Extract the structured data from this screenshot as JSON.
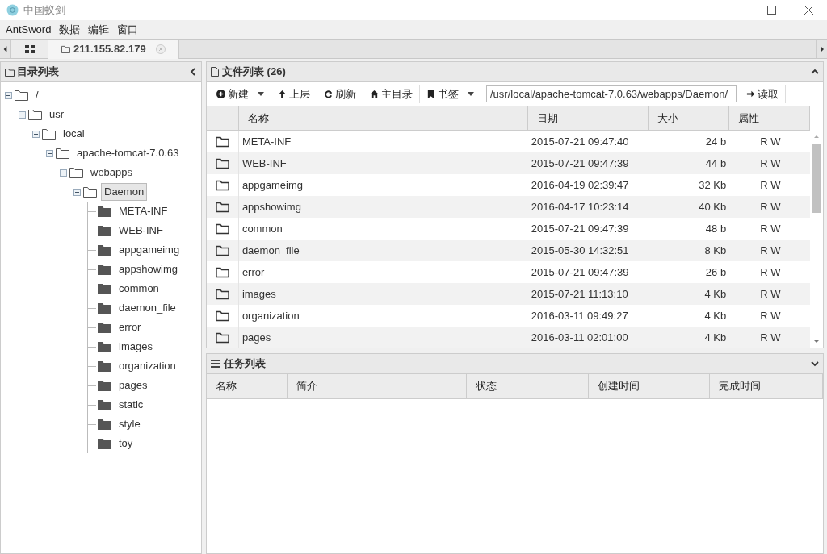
{
  "window": {
    "title": "中国蚁剑"
  },
  "menu": [
    "AntSword",
    "数据",
    "编辑",
    "窗口"
  ],
  "tabs": [
    {
      "label": "211.155.82.179",
      "selected": true
    }
  ],
  "directory_panel": {
    "title": "目录列表",
    "tree": [
      {
        "label": "/",
        "expanded": true,
        "selected": false,
        "children": [
          {
            "label": "usr",
            "expanded": true,
            "selected": false,
            "children": [
              {
                "label": "local",
                "expanded": true,
                "selected": false,
                "children": [
                  {
                    "label": "apache-tomcat-7.0.63",
                    "expanded": true,
                    "selected": false,
                    "children": [
                      {
                        "label": "webapps",
                        "expanded": true,
                        "selected": false,
                        "children": [
                          {
                            "label": "Daemon",
                            "expanded": true,
                            "selected": true,
                            "children": [
                              {
                                "label": "META-INF",
                                "selected": false
                              },
                              {
                                "label": "WEB-INF",
                                "selected": false
                              },
                              {
                                "label": "appgameimg",
                                "selected": false
                              },
                              {
                                "label": "appshowimg",
                                "selected": false
                              },
                              {
                                "label": "common",
                                "selected": false
                              },
                              {
                                "label": "daemon_file",
                                "selected": false
                              },
                              {
                                "label": "error",
                                "selected": false
                              },
                              {
                                "label": "images",
                                "selected": false
                              },
                              {
                                "label": "organization",
                                "selected": false
                              },
                              {
                                "label": "pages",
                                "selected": false
                              },
                              {
                                "label": "static",
                                "selected": false
                              },
                              {
                                "label": "style",
                                "selected": false
                              },
                              {
                                "label": "toy",
                                "selected": false
                              }
                            ]
                          }
                        ]
                      }
                    ]
                  }
                ]
              }
            ]
          }
        ]
      }
    ]
  },
  "file_panel": {
    "title": "文件列表 (26)",
    "toolbar": [
      {
        "kind": "dropdown",
        "label": "新建"
      },
      {
        "kind": "button",
        "label": "上层"
      },
      {
        "kind": "button",
        "label": "刷新"
      },
      {
        "kind": "button",
        "label": "主目录"
      },
      {
        "kind": "dropdown",
        "label": "书签"
      },
      {
        "kind": "field",
        "value": "/usr/local/apache-tomcat-7.0.63/webapps/Daemon/"
      },
      {
        "kind": "button",
        "label": "读取"
      }
    ],
    "columns": [
      "名称",
      "日期",
      "大小",
      "属性"
    ],
    "rows": [
      {
        "name": "META-INF",
        "date": "2015-07-21 09:47:40",
        "size": "24 b",
        "attr": "R W"
      },
      {
        "name": "WEB-INF",
        "date": "2015-07-21 09:47:39",
        "size": "44 b",
        "attr": "R W"
      },
      {
        "name": "appgameimg",
        "date": "2016-04-19 02:39:47",
        "size": "32 Kb",
        "attr": "R W"
      },
      {
        "name": "appshowimg",
        "date": "2016-04-17 10:23:14",
        "size": "40 Kb",
        "attr": "R W"
      },
      {
        "name": "common",
        "date": "2015-07-21 09:47:39",
        "size": "48 b",
        "attr": "R W"
      },
      {
        "name": "daemon_file",
        "date": "2015-05-30 14:32:51",
        "size": "8 Kb",
        "attr": "R W"
      },
      {
        "name": "error",
        "date": "2015-07-21 09:47:39",
        "size": "26 b",
        "attr": "R W"
      },
      {
        "name": "images",
        "date": "2015-07-21 11:13:10",
        "size": "4 Kb",
        "attr": "R W"
      },
      {
        "name": "organization",
        "date": "2016-03-11 09:49:27",
        "size": "4 Kb",
        "attr": "R W"
      },
      {
        "name": "pages",
        "date": "2016-03-11 02:01:00",
        "size": "4 Kb",
        "attr": "R W"
      }
    ]
  },
  "task_panel": {
    "title": "任务列表",
    "columns": [
      "名称",
      "简介",
      "状态",
      "创建时间",
      "完成时间"
    ]
  }
}
